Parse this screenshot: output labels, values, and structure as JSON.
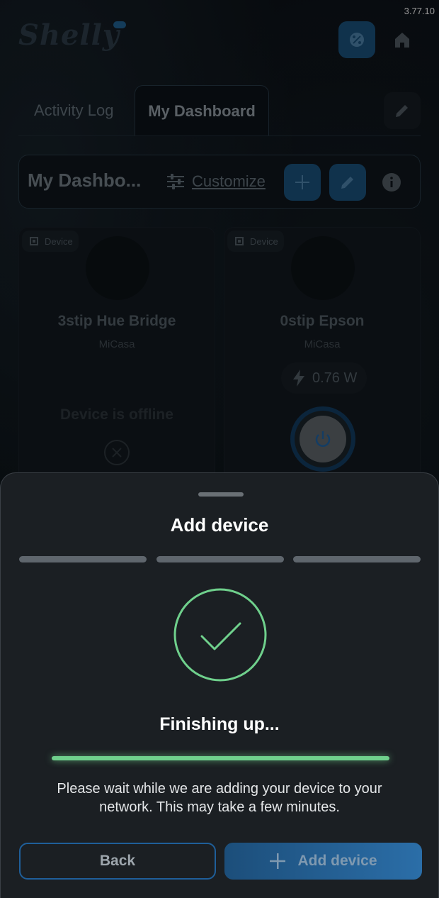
{
  "app": {
    "version": "3.77.10",
    "logo_text": "Shelly"
  },
  "tabs": [
    {
      "label": "Activity Log",
      "active": false
    },
    {
      "label": "My Dashboard",
      "active": true
    }
  ],
  "dashboard": {
    "title": "My Dashbo...",
    "customize_label": "Customize"
  },
  "devices": [
    {
      "tag": "Device",
      "name": "3stip Hue Bridge",
      "room": "MiCasa",
      "status": "Device is offline",
      "power": null
    },
    {
      "tag": "Device",
      "name": "0stip Epson",
      "room": "MiCasa",
      "status": "on",
      "power": "0.76 W"
    }
  ],
  "sheet": {
    "title": "Add device",
    "steps_total": 3,
    "status_text": "Finishing up...",
    "progress": 1.0,
    "description": "Please wait while we are adding your device to your network. This may take a few minutes.",
    "back_label": "Back",
    "add_label": "Add device"
  },
  "colors": {
    "accent": "#2b6ea8",
    "success": "#6fd08c",
    "sheet_bg": "#1b1f23"
  }
}
